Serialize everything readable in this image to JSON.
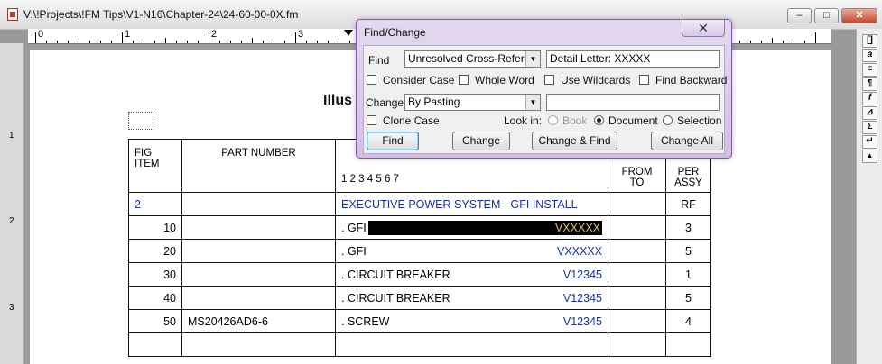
{
  "window": {
    "title": "V:\\!Projects\\!FM Tips\\V1-N16\\Chapter-24\\24-60-00-0X.fm",
    "minimize_glyph": "–",
    "restore_glyph": "□",
    "close_glyph": "✕"
  },
  "ruler": {
    "labels": [
      "0",
      "1",
      "2",
      "3"
    ]
  },
  "vruler": {
    "labels": [
      "1",
      "2",
      "3"
    ]
  },
  "toolbar_right": {
    "glyphs": [
      "[]",
      "a",
      "≡",
      "¶",
      "f",
      "⊿",
      "Σ",
      "↵",
      "▲"
    ]
  },
  "page": {
    "title": "Illus",
    "table": {
      "headers": {
        "fig": "FIG ITEM",
        "part": "PART NUMBER",
        "desc_digits": "1 2 3 4 5 6 7",
        "from": "FROM TO",
        "per": "PER ASSY"
      },
      "rows": [
        {
          "fig": "2",
          "part": "",
          "desc": "EXECUTIVE POWER SYSTEM - GFI INSTALL",
          "code": "",
          "from": "",
          "per": "RF",
          "style": "header"
        },
        {
          "fig": "10",
          "part": "",
          "desc": ". GFI",
          "code": "VXXXXX",
          "from": "",
          "per": "3",
          "style": "highlight"
        },
        {
          "fig": "20",
          "part": "",
          "desc": ". GFI",
          "code": "VXXXXX",
          "from": "",
          "per": "5",
          "style": "normal"
        },
        {
          "fig": "30",
          "part": "",
          "desc": ". CIRCUIT BREAKER",
          "code": "V12345",
          "from": "",
          "per": "1",
          "style": "normal"
        },
        {
          "fig": "40",
          "part": "",
          "desc": ". CIRCUIT BREAKER",
          "code": "V12345",
          "from": "",
          "per": "5",
          "style": "normal"
        },
        {
          "fig": "50",
          "part": "MS20426AD6-6",
          "desc": ". SCREW",
          "code": "V12345",
          "from": "",
          "per": "4",
          "style": "normal"
        },
        {
          "fig": "",
          "part": "",
          "desc": "",
          "code": "",
          "from": "",
          "per": "",
          "style": "empty"
        }
      ]
    }
  },
  "dialog": {
    "title": "Find/Change",
    "close_glyph": "✕",
    "find_label": "Find",
    "find_type": "Unresolved Cross-Reference",
    "find_text": "Detail Letter: XXXXX",
    "consider_case": "Consider Case",
    "whole_word": "Whole Word",
    "use_wildcards": "Use Wildcards",
    "find_backward": "Find Backward",
    "change_label": "Change",
    "change_type": "By Pasting",
    "change_text": "",
    "clone_case": "Clone Case",
    "look_in": "Look in:",
    "opt_book": "Book",
    "opt_document": "Document",
    "opt_selection": "Selection",
    "btn_find": "Find",
    "btn_change": "Change",
    "btn_change_find": "Change & Find",
    "btn_change_all": "Change All"
  },
  "colors": {
    "link_blue": "#1b2fa8",
    "highlight_text": "#d9c34a",
    "dialog_frame": "#d2c0e4"
  }
}
